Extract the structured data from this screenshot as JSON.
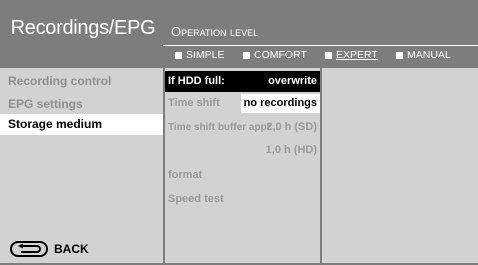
{
  "header": {
    "title": "Recordings/EPG",
    "operation_level": "Operation level",
    "levels": [
      {
        "label": "SIMPLE",
        "active": false
      },
      {
        "label": "COMFORT",
        "active": false
      },
      {
        "label": "EXPERT",
        "active": true
      },
      {
        "label": "MANUAL",
        "active": false
      }
    ]
  },
  "sidebar": {
    "items": [
      {
        "label": "Recording control",
        "selected": false
      },
      {
        "label": "EPG settings",
        "selected": false
      },
      {
        "label": "Storage medium",
        "selected": true
      }
    ],
    "back_label": "BACK"
  },
  "settings": {
    "hdd_full": {
      "label": "If HDD full:",
      "value": "overwrite"
    },
    "time_shift": {
      "label": "Time shift",
      "value": "no recordings"
    },
    "buffer": {
      "label": "Time shift buffer appr...",
      "value_sd": "2,0 h (SD)",
      "value_hd": "1,0 h (HD)"
    },
    "format": {
      "label": "format"
    },
    "speed_test": {
      "label": "Speed test"
    }
  },
  "colors": {
    "header_bg": "#7d7d7d",
    "panel_bg": "#d2d2d2",
    "highlight": "#000000",
    "selected_bg": "#ffffff"
  }
}
